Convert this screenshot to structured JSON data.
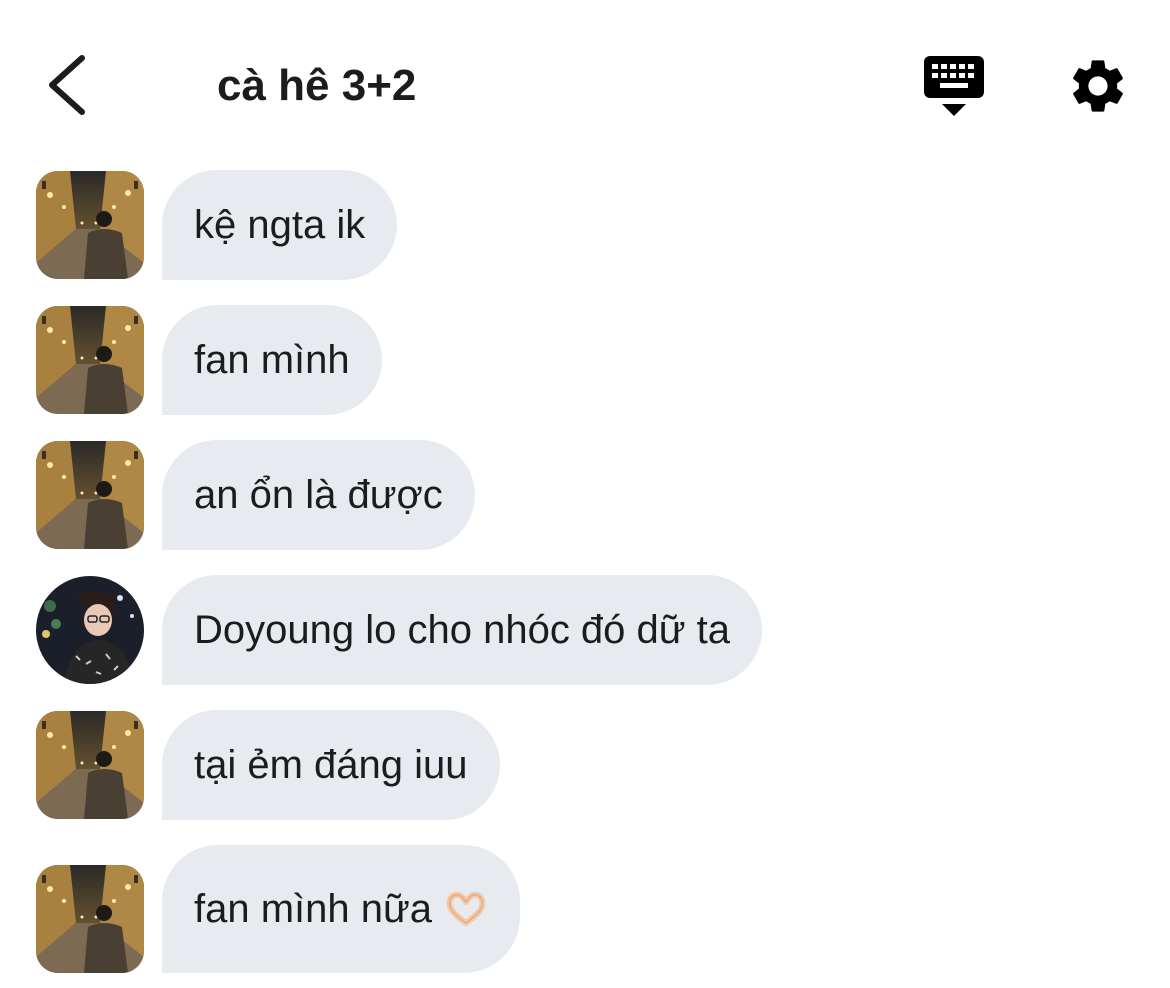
{
  "header": {
    "title": "cà hê 3+2"
  },
  "icons": {
    "back": "chevron-left-icon",
    "keyboard": "keyboard-hide-icon",
    "settings": "gear-icon"
  },
  "colors": {
    "bubble": "#e7ebf0",
    "text": "#1c1c1e",
    "background": "#ffffff"
  },
  "messages": [
    {
      "text": "kệ ngta ik",
      "avatar": "street-night-photo"
    },
    {
      "text": "fan mình",
      "avatar": "street-night-photo"
    },
    {
      "text": "an ổn là được",
      "avatar": "street-night-photo"
    },
    {
      "text": "Doyoung lo cho nhóc đó dữ ta",
      "avatar": "person-portrait-photo"
    },
    {
      "text": "tại ẻm đáng iuu",
      "avatar": "street-night-photo"
    },
    {
      "text": "fan mình nữa",
      "avatar": "street-night-photo",
      "emoji": "heart-hands-emoji"
    }
  ]
}
